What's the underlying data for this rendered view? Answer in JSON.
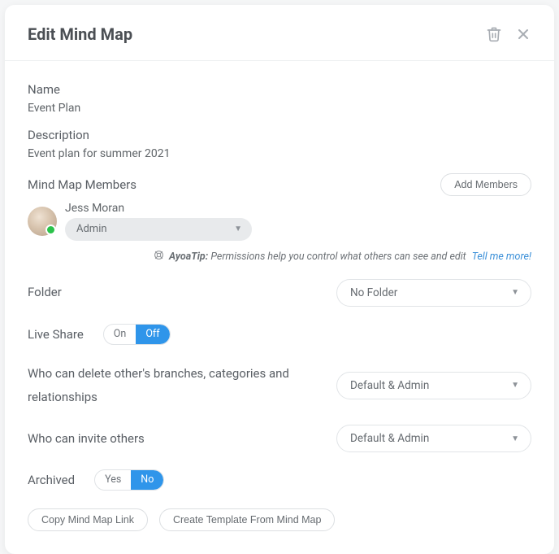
{
  "header": {
    "title": "Edit Mind Map"
  },
  "name": {
    "label": "Name",
    "value": "Event Plan"
  },
  "description": {
    "label": "Description",
    "value": "Event plan for summer 2021"
  },
  "members": {
    "label": "Mind Map Members",
    "add_label": "Add Members",
    "list": [
      {
        "name": "Jess Moran",
        "role": "Admin"
      }
    ]
  },
  "tip": {
    "prefix": "AyoaTip:",
    "text": "Permissions help you control what others can see and edit",
    "link": "Tell me more!"
  },
  "folder": {
    "label": "Folder",
    "value": "No Folder"
  },
  "liveshare": {
    "label": "Live Share",
    "on": "On",
    "off": "Off",
    "value": "Off"
  },
  "delete_perm": {
    "label": "Who can delete other's branches, categories and relationships",
    "value": "Default & Admin"
  },
  "invite_perm": {
    "label": "Who can invite others",
    "value": "Default & Admin"
  },
  "archived": {
    "label": "Archived",
    "yes": "Yes",
    "no": "No",
    "value": "No"
  },
  "actions": {
    "copy": "Copy Mind Map Link",
    "template": "Create Template From Mind Map"
  }
}
